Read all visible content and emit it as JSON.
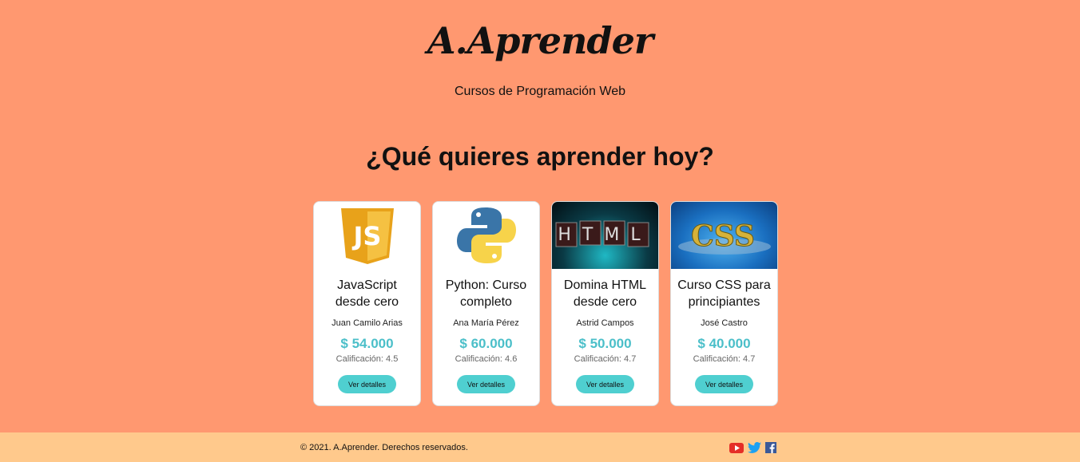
{
  "header": {
    "brand": "A.Aprender",
    "tagline": "Cursos de Programación Web"
  },
  "main": {
    "headline": "¿Qué quieres aprender hoy?"
  },
  "courses": [
    {
      "title": "JavaScript desde cero",
      "author": "Juan Camilo Arias",
      "price": "$ 54.000",
      "rating": "Calificación: 4.5",
      "button": "Ver detalles",
      "thumb": "javascript-logo"
    },
    {
      "title": "Python: Curso completo",
      "author": "Ana María Pérez",
      "price": "$ 60.000",
      "rating": "Calificación: 4.6",
      "button": "Ver detalles",
      "thumb": "python-logo"
    },
    {
      "title": "Domina HTML desde cero",
      "author": "Astrid Campos",
      "price": "$ 50.000",
      "rating": "Calificación: 4.7",
      "button": "Ver detalles",
      "thumb": "html-image"
    },
    {
      "title": "Curso CSS para principiantes",
      "author": "José Castro",
      "price": "$ 40.000",
      "rating": "Calificación: 4.7",
      "button": "Ver detalles",
      "thumb": "css-image"
    }
  ],
  "thumbs": {
    "javascript_text": "JS",
    "html_text": "HTML",
    "css_text": "CSS"
  },
  "footer": {
    "copyright": "© 2021. A.Aprender. Derechos reservados.",
    "social": [
      "youtube-icon",
      "twitter-icon",
      "facebook-icon"
    ]
  },
  "colors": {
    "background": "#ff9870",
    "footer": "#ffc98c",
    "accent": "#4bbfc9",
    "button": "#4fcfd0"
  }
}
